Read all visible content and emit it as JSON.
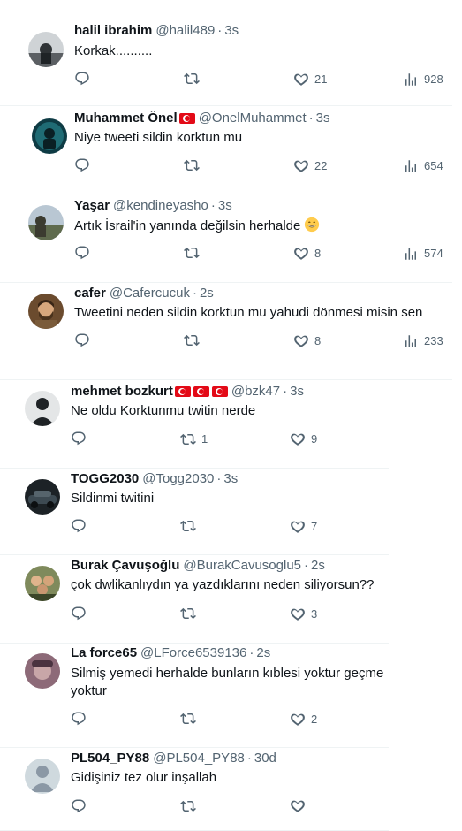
{
  "tweets": [
    {
      "name": "halil ibrahim",
      "flags": 0,
      "handle": "@halil489",
      "time": "3s",
      "text": "Korkak..........",
      "replies": "",
      "retweets": "",
      "likes": "21",
      "views": "928"
    },
    {
      "name": "Muhammet Önel",
      "flags": 1,
      "handle": "@OnelMuhammet",
      "time": "3s",
      "text": "Niye tweeti sildin korktun mu",
      "replies": "",
      "retweets": "",
      "likes": "22",
      "views": "654"
    },
    {
      "name": "Yaşar",
      "flags": 0,
      "handle": "@kendineyasho",
      "time": "3s",
      "text": "Artık İsrail'in yanında değilsin herhalde",
      "replies": "",
      "retweets": "",
      "likes": "8",
      "views": "574"
    },
    {
      "name": "cafer",
      "flags": 0,
      "handle": "@Cafercucuk",
      "time": "2s",
      "text": "Tweetini neden sildin korktun mu yahudi dönmesi misin sen",
      "replies": "",
      "retweets": "",
      "likes": "8",
      "views": "233"
    },
    {
      "name": "mehmet bozkurt",
      "flags": 3,
      "handle": "@bzk47",
      "time": "3s",
      "text": "Ne oldu Korktunmu twitin nerde",
      "replies": "",
      "retweets": "1",
      "likes": "9",
      "views": ""
    },
    {
      "name": "TOGG2030",
      "flags": 0,
      "handle": "@Togg2030",
      "time": "3s",
      "text": "Sildinmi twitini",
      "replies": "",
      "retweets": "",
      "likes": "7",
      "views": ""
    },
    {
      "name": "Burak Çavuşoğlu",
      "flags": 0,
      "handle": "@BurakCavusoglu5",
      "time": "2s",
      "text": "çok dwlikanlıydın ya yazdıklarını neden siliyorsun??",
      "replies": "",
      "retweets": "",
      "likes": "3",
      "views": ""
    },
    {
      "name": "La force65",
      "flags": 0,
      "handle": "@LForce6539136",
      "time": "2s",
      "text": "Silmiş yemedi herhalde bunların kıblesi yoktur geçme\nyoktur",
      "replies": "",
      "retweets": "",
      "likes": "2",
      "views": ""
    },
    {
      "name": "PL504_PY88",
      "flags": 0,
      "handle": "@PL504_PY88",
      "time": "30d",
      "text": "Gidişiniz tez olur inşallah",
      "replies": "",
      "retweets": "",
      "likes": "",
      "views": ""
    }
  ],
  "icons": {
    "reply": "reply-icon",
    "retweet": "retweet-icon",
    "like": "like-icon",
    "views": "views-icon",
    "emoji": "grinning-face-emoji"
  },
  "colors": {
    "text": "#0f1419",
    "secondary": "#536471",
    "divider": "#eff3f4",
    "flag": "#e30a17"
  }
}
